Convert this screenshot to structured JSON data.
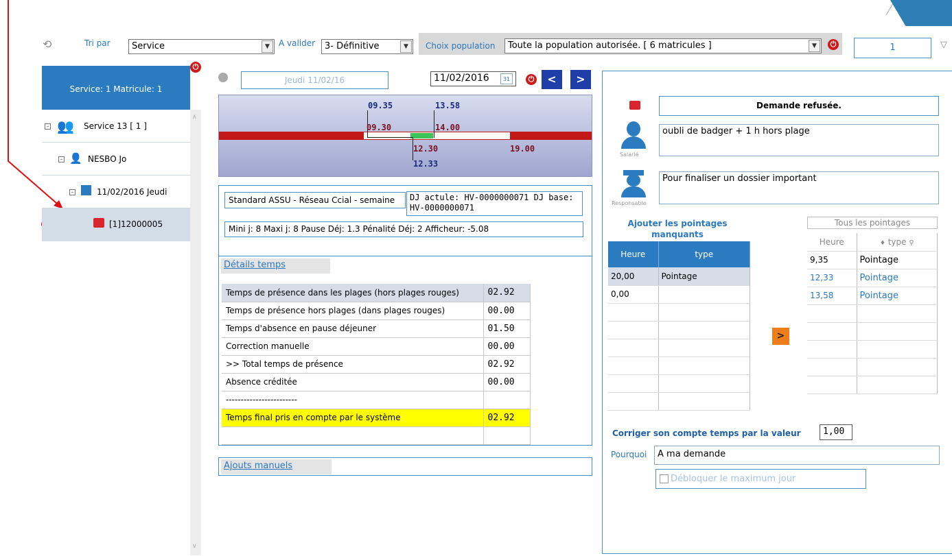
{
  "toolbar": {
    "tri_par_label": "Tri par",
    "tri_par_value": "Service",
    "a_valider_label": "A valider",
    "a_valider_value": "3- Définitive",
    "choix_population_label": "Choix population",
    "choix_population_value": "Toute la population autorisée. [ 6 matricules ]",
    "page_value": "1"
  },
  "left": {
    "header": "Service: 1 Matricule: 1",
    "tree": {
      "service": "Service 13 [ 1 ]",
      "employee": "NESBO Jo",
      "date": "11/02/2016 Jeudi",
      "request": "[1]12000005"
    }
  },
  "nav": {
    "day_label": "Jeudi 11/02/16",
    "date_value": "11/02/2016",
    "calendar_day": "31"
  },
  "timeline": {
    "top_labels": [
      "09.35",
      "13.58"
    ],
    "mid_labels": [
      "09.30",
      "14.00"
    ],
    "bottom_labels": [
      "12.30",
      "19.00"
    ],
    "lower_label": "12.33"
  },
  "schedule": {
    "name": "Standard ASSU - Réseau Ccial - semaine",
    "dj_info": "DJ actule: HV-0000000071 DJ base: HV-0000000071",
    "limits": "Mini j: 8 Maxi j: 8 Pause Déj: 1.3 Pénalité Déj: 2 Afficheur: -5.08"
  },
  "details": {
    "title": "Détails temps",
    "rows": [
      {
        "label": "Temps de présence dans les plages (hors plages rouges)",
        "value": "02.92"
      },
      {
        "label": "Temps de présence hors plages (dans plages rouges)",
        "value": "00.00"
      },
      {
        "label": "Temps d'absence en pause déjeuner",
        "value": "01.50"
      },
      {
        "label": "Correction manuelle",
        "value": "00.00"
      },
      {
        "label": ">> Total temps de présence",
        "value": "02.92"
      },
      {
        "label": "Absence créditée",
        "value": "00.00"
      },
      {
        "label": "------------------------",
        "value": ""
      },
      {
        "label": "Temps final pris en compte par le système",
        "value": "02.92"
      }
    ],
    "ajouts_title": "Ajouts manuels"
  },
  "right": {
    "status": "Demande refusée.",
    "salarie_label": "Salarié",
    "salarie_comment": "oubli de badger + 1 h hors plage",
    "responsable_label": "Responsable",
    "responsable_comment": "Pour finaliser un dossier important",
    "add_title": "Ajouter les pointages manquants",
    "add_headers": [
      "Heure",
      "type"
    ],
    "add_rows": [
      {
        "heure": "20,00",
        "type": "Pointage"
      },
      {
        "heure": "0,00",
        "type": ""
      }
    ],
    "all_title": "Tous les pointages",
    "all_headers": [
      "Heure",
      "type"
    ],
    "all_rows": [
      {
        "heure": "9,35",
        "type": "Pointage"
      },
      {
        "heure": "12,33",
        "type": "Pointage"
      },
      {
        "heure": "13,58",
        "type": "Pointage"
      }
    ],
    "corriger_label": "Corriger son compte temps par la valeur",
    "corriger_value": "1,00",
    "pourquoi_label": "Pourquoi",
    "pourquoi_value": "A ma demande",
    "debloquer_label": "Débloquer le maximum jour"
  }
}
